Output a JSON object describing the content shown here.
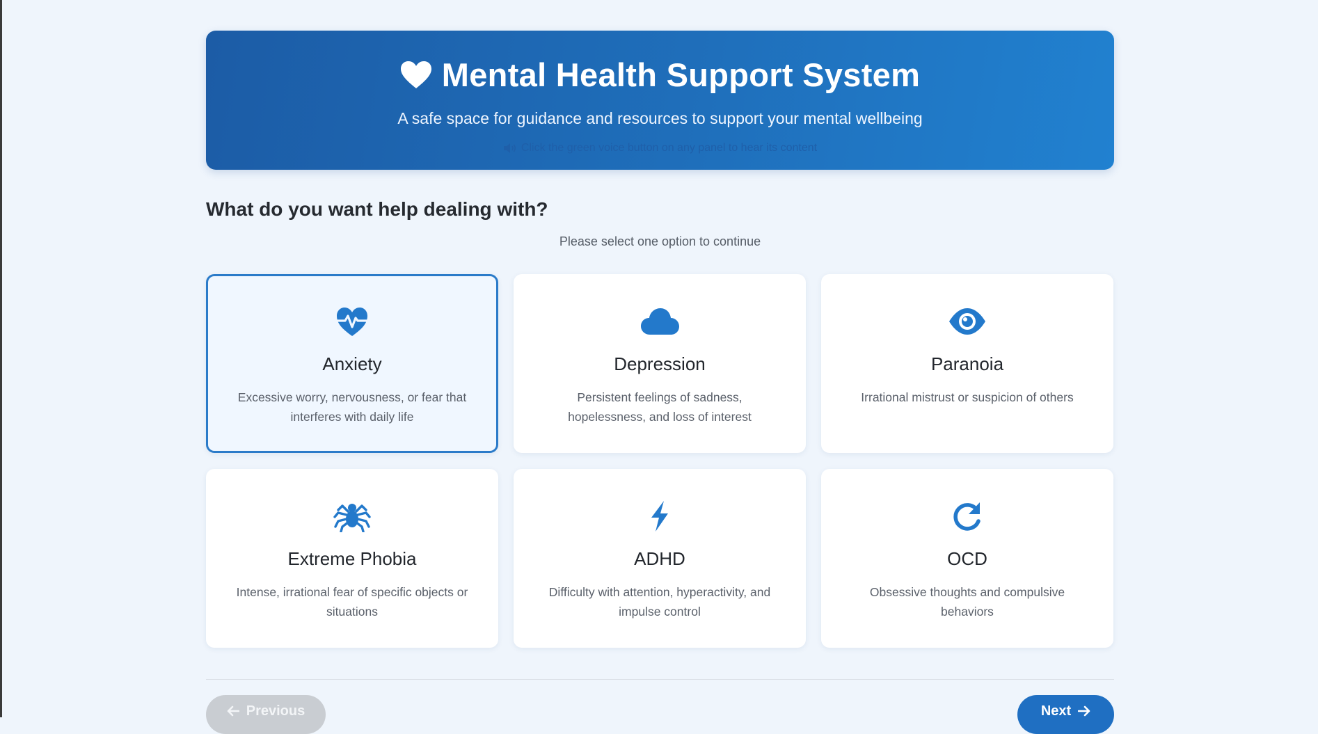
{
  "header": {
    "title": "Mental Health Support System",
    "subtitle": "A safe space for guidance and resources to support your mental wellbeing",
    "voice_hint": "Click the green voice button on any panel to hear its content",
    "icon": "heart-icon"
  },
  "question": {
    "heading": "What do you want help dealing with?",
    "prompt": "Please select one option to continue"
  },
  "options": [
    {
      "icon": "heartbeat-icon",
      "title": "Anxiety",
      "description": "Excessive worry, nervousness, or fear that interferes with daily life",
      "selected": true
    },
    {
      "icon": "cloud-icon",
      "title": "Depression",
      "description": "Persistent feelings of sadness, hopelessness, and loss of interest",
      "selected": false
    },
    {
      "icon": "eye-icon",
      "title": "Paranoia",
      "description": "Irrational mistrust or suspicion of others",
      "selected": false
    },
    {
      "icon": "spider-icon",
      "title": "Extreme Phobia",
      "description": "Intense, irrational fear of specific objects or situations",
      "selected": false
    },
    {
      "icon": "lightning-bolt-icon",
      "title": "ADHD",
      "description": "Difficulty with attention, hyperactivity, and impulse control",
      "selected": false
    },
    {
      "icon": "redo-arrow-icon",
      "title": "OCD",
      "description": "Obsessive thoughts and compulsive behaviors",
      "selected": false
    }
  ],
  "navigation": {
    "previous_label": "Previous",
    "next_label": "Next"
  },
  "colors": {
    "accent": "#1f6fc2",
    "header_start": "#1c5ca6",
    "header_end": "#2181d0",
    "page_background": "#eff5fc",
    "selected_border": "#2b7bc9",
    "disabled_button": "#c9cdd2"
  }
}
